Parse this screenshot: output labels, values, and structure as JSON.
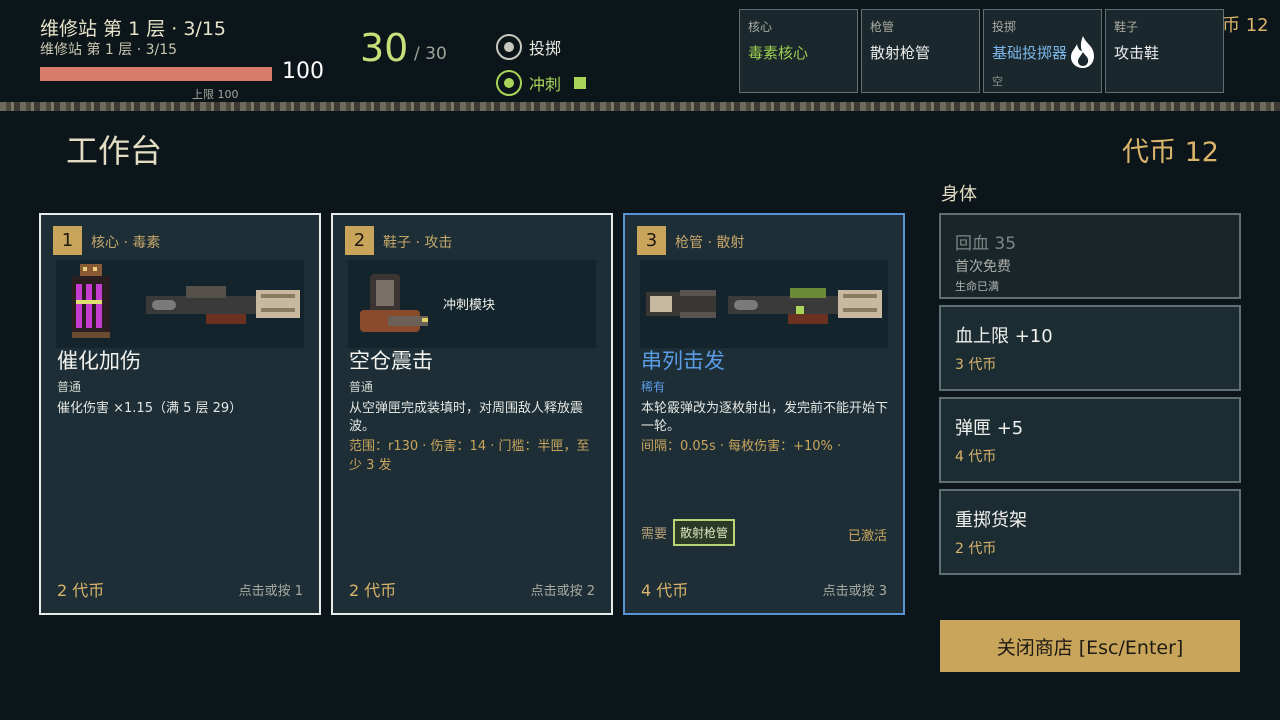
{
  "hud": {
    "title": "维修站 第 1 层 · 3/15",
    "subtitle": "维修站 第 1 层 · 3/15",
    "hp": 100,
    "hp_fraction": 1.0,
    "hp_value": "100",
    "hp_max_label": "上限 100",
    "ammo": "30",
    "ammo_max": "/ 30",
    "skills": {
      "throw": "投掷",
      "dash": "冲刺"
    },
    "slots": {
      "core": {
        "cat": "核心",
        "item": "毒素核心"
      },
      "barrel": {
        "cat": "枪管",
        "item": "散射枪管"
      },
      "throw": {
        "cat": "投掷",
        "item": "基础投掷器",
        "note": "空"
      },
      "shoe": {
        "cat": "鞋子",
        "item": "攻击鞋"
      }
    },
    "tokens": "币 12"
  },
  "panel": {
    "title": "工作台",
    "tokens": "代币 12"
  },
  "cards": [
    {
      "num": "1",
      "tag": "核心 · 毒素",
      "name": "催化加伤",
      "rarity": "普通",
      "desc": "催化伤害 ×1.15（满 5 层 29）",
      "price": "2 代币",
      "key": "点击或按 1"
    },
    {
      "num": "2",
      "tag": "鞋子 · 攻击",
      "image_label": "冲刺模块",
      "name": "空仓震击",
      "rarity": "普通",
      "desc": "从空弹匣完成装填时，对周围敌人释放震波。",
      "stats": "范围：r130 · 伤害：14 · 门槛：半匣，至少 3 发",
      "price": "2 代币",
      "key": "点击或按 2"
    },
    {
      "num": "3",
      "tag": "枪管 · 散射",
      "name": "串列击发",
      "rarity": "稀有",
      "desc": "本轮霰弹改为逐枚射出，发完前不能开始下一轮。",
      "stats": "间隔：0.05s · 每枚伤害：+10% ·",
      "req_label": "需要",
      "req_item": "散射枪管",
      "status": "已激活",
      "price": "4 代币",
      "key": "点击或按 3"
    }
  ],
  "body_section": {
    "title": "身体",
    "options": [
      {
        "title": "回血 35",
        "cost": "首次免费",
        "note": "生命已满"
      },
      {
        "title": "血上限 +10",
        "cost": "3 代币"
      },
      {
        "title": "弹匣 +5",
        "cost": "4 代币"
      },
      {
        "title": "重掷货架",
        "cost": "2 代币"
      }
    ]
  },
  "close_button": "关闭商店 [Esc/Enter]"
}
